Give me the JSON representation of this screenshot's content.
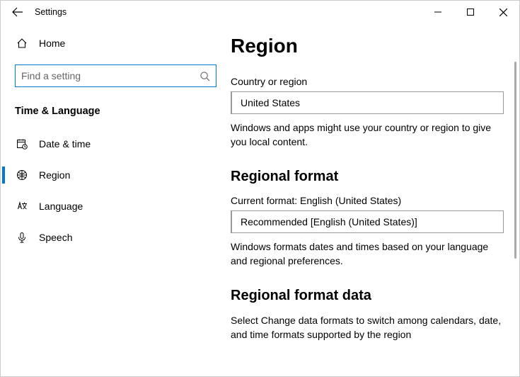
{
  "window": {
    "title": "Settings"
  },
  "sidebar": {
    "home_label": "Home",
    "search_placeholder": "Find a setting",
    "category_title": "Time & Language",
    "items": [
      {
        "label": "Date & time"
      },
      {
        "label": "Region"
      },
      {
        "label": "Language"
      },
      {
        "label": "Speech"
      }
    ]
  },
  "main": {
    "heading": "Region",
    "country": {
      "label": "Country or region",
      "value": "United States",
      "hint": "Windows and apps might use your country or region to give you local content."
    },
    "regional_format": {
      "title": "Regional format",
      "current_label": "Current format: English (United States)",
      "value": "Recommended [English (United States)]",
      "hint": "Windows formats dates and times based on your language and regional preferences."
    },
    "regional_format_data": {
      "title": "Regional format data",
      "hint": "Select Change data formats to switch among calendars, date, and time formats supported by the region"
    }
  }
}
